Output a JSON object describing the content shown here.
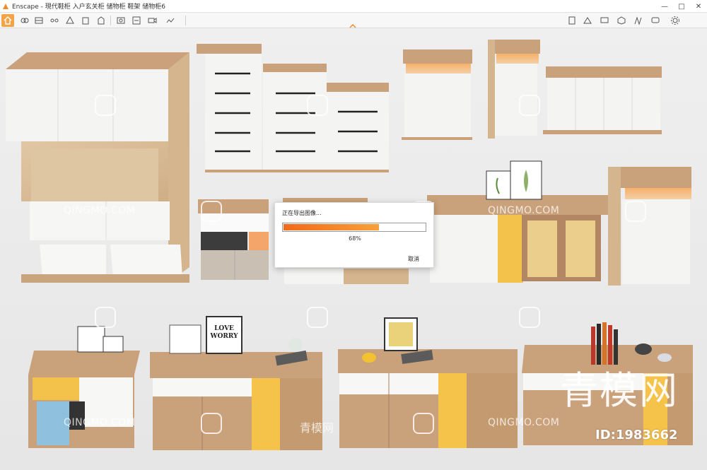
{
  "window": {
    "app_name": "Enscape",
    "title": "Enscape - 現代鞋柜 入户玄关柜 储物柜 鞋架 储物柜6"
  },
  "toolbar": {
    "left_icons": [
      "home-icon",
      "link-icon",
      "bim-icon",
      "grid-icon",
      "eye-icon",
      "compass-icon",
      "building-icon",
      "panel-icon",
      "screenshot-icon",
      "batch-render-icon",
      "video-export-icon",
      "panorama-icon"
    ],
    "right_icons": [
      "book-icon",
      "asset-icon",
      "monitor-icon",
      "cube-icon",
      "material-icon",
      "chat-icon",
      "settings-icon"
    ]
  },
  "dialog": {
    "title": "正在导出图像...",
    "progress_percent": 68,
    "progress_label": "68%",
    "cancel_label": "取消"
  },
  "posters": {
    "love_worry": "LOVE WORRY"
  },
  "watermarks": {
    "latin": "QINGMO.COM",
    "chinese": "青模网",
    "brand": "青模网",
    "id": "ID:1983662"
  },
  "colors": {
    "progress": "#f26a1b",
    "active_tool": "#f4a347",
    "wood": "#c7a27a",
    "white_panel": "#f5f5f3",
    "yellow_panel": "#f2c24a",
    "blue_panel": "#8fc0dd"
  }
}
